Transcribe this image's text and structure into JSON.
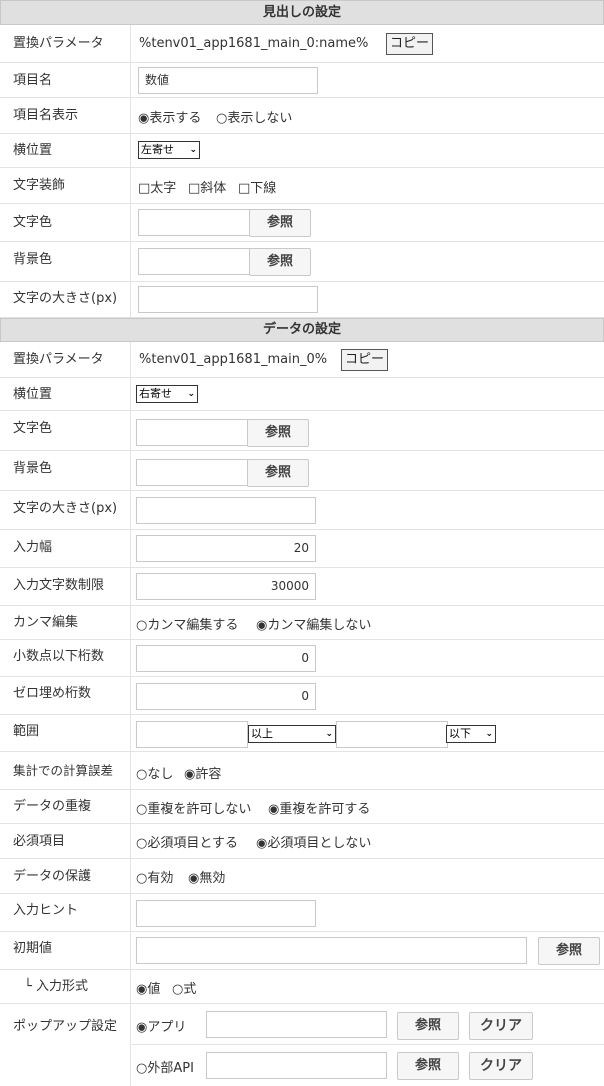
{
  "heading_section": {
    "title": "見出しの設定",
    "rows": {
      "param_label": "置換パラメータ",
      "param_value": "%tenv01_app1681_main_0:name%",
      "copy_label": "コピー",
      "item_name_label": "項目名",
      "item_name_value": "数値",
      "display_label": "項目名表示",
      "display_opt1": "◉表示する",
      "display_opt2": "○表示しない",
      "align_label": "横位置",
      "align_value": "左寄せ",
      "deco_label": "文字装飾",
      "deco_opt1": "□太字",
      "deco_opt2": "□斜体",
      "deco_opt3": "□下線",
      "color_label": "文字色",
      "bg_label": "背景色",
      "size_label": "文字の大きさ(px)",
      "ref_label": "参照"
    }
  },
  "data_section": {
    "title": "データの設定",
    "rows": {
      "param_label": "置換パラメータ",
      "param_value": "%tenv01_app1681_main_0%",
      "copy_label": "コピー",
      "align_label": "横位置",
      "align_value": "右寄せ",
      "color_label": "文字色",
      "bg_label": "背景色",
      "size_label": "文字の大きさ(px)",
      "width_label": "入力幅",
      "width_value": "20",
      "maxlen_label": "入力文字数制限",
      "maxlen_value": "30000",
      "comma_label": "カンマ編集",
      "comma_opt1": "○カンマ編集する",
      "comma_opt2": "◉カンマ編集しない",
      "decimal_label": "小数点以下桁数",
      "decimal_value": "0",
      "zero_label": "ゼロ埋め桁数",
      "zero_value": "0",
      "range_label": "範囲",
      "range_sel1": "以上",
      "range_sel2": "以下",
      "calc_label": "集計での計算誤差",
      "calc_opt1": "○なし",
      "calc_opt2": "◉許容",
      "dup_label": "データの重複",
      "dup_opt1": "○重複を許可しない",
      "dup_opt2": "◉重複を許可する",
      "req_label": "必須項目",
      "req_opt1": "○必須項目とする",
      "req_opt2": "◉必須項目としない",
      "protect_label": "データの保護",
      "protect_opt1": "○有効",
      "protect_opt2": "◉無効",
      "hint_label": "入力ヒント",
      "init_label": "初期値",
      "format_label": "└ 入力形式",
      "format_opt1": "◉値",
      "format_opt2": "○式",
      "popup_label": "ポップアップ設定",
      "popup_opt1": "◉アプリ",
      "popup_opt2": "○外部API",
      "ref_label": "参照",
      "clear_label": "クリア"
    }
  }
}
